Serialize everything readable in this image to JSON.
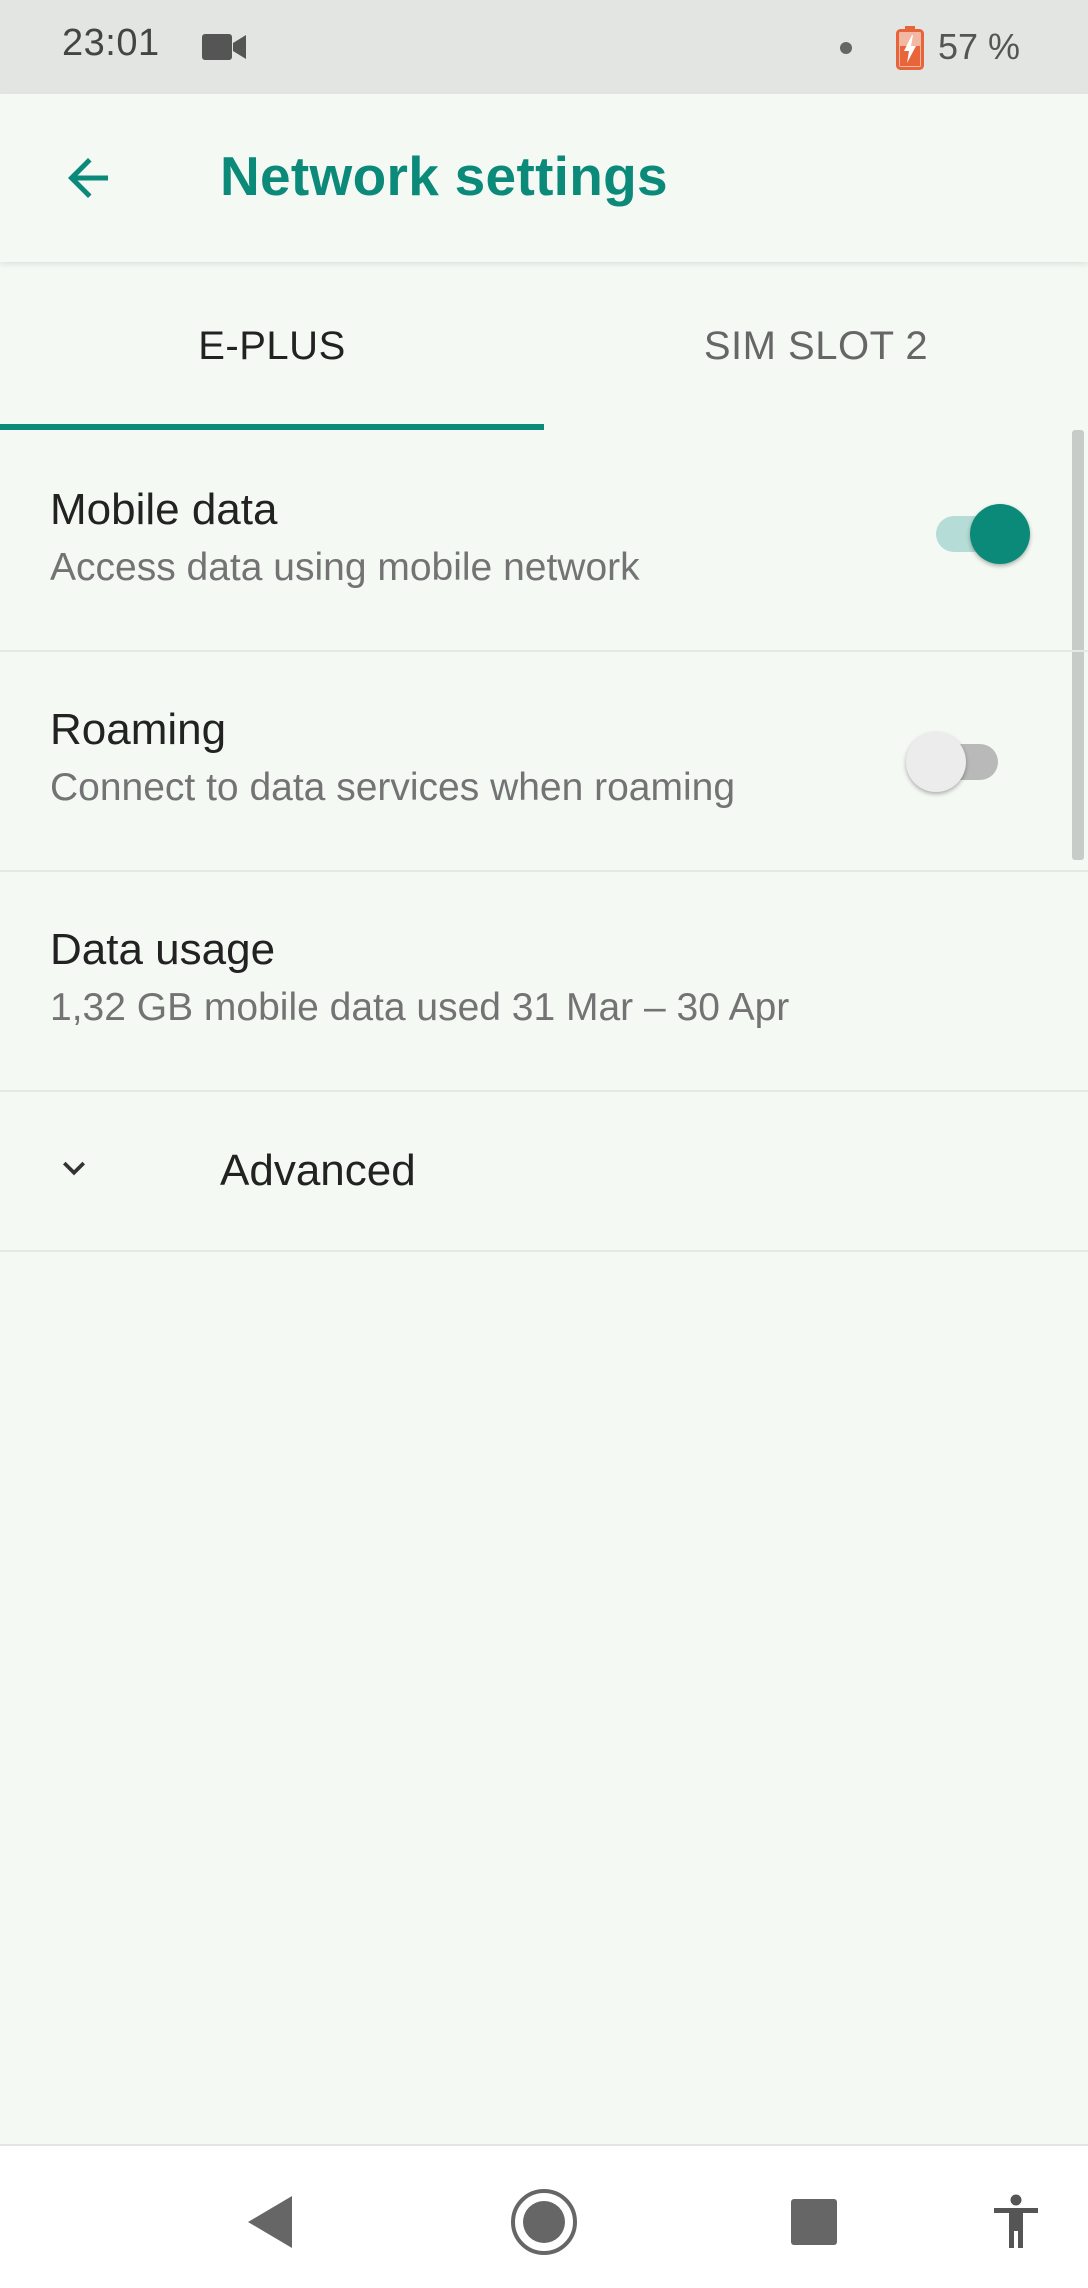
{
  "status_bar": {
    "time": "23:01",
    "battery_percent": "57 %",
    "icons": [
      "video-camera-icon",
      "notification-dot-icon",
      "battery-charging-icon"
    ],
    "battery_color": "#e8643a"
  },
  "toolbar": {
    "title": "Network settings",
    "back_icon": "arrow-left-icon",
    "accent_color": "#0b8a7a"
  },
  "tabs": [
    {
      "label": "E-PLUS",
      "selected": true
    },
    {
      "label": "SIM SLOT 2",
      "selected": false
    }
  ],
  "preferences": [
    {
      "title": "Mobile data",
      "summary": "Access data using mobile network",
      "switch": "on"
    },
    {
      "title": "Roaming",
      "summary": "Connect to data services when roaming",
      "switch": "off"
    },
    {
      "title": "Data usage",
      "summary": "1,32 GB mobile data used 31 Mar – 30 Apr"
    }
  ],
  "advanced": {
    "label": "Advanced",
    "icon": "chevron-down-icon"
  },
  "nav_bar": {
    "icons": [
      "back-triangle-icon",
      "home-circle-icon",
      "recents-square-icon",
      "accessibility-icon"
    ]
  }
}
